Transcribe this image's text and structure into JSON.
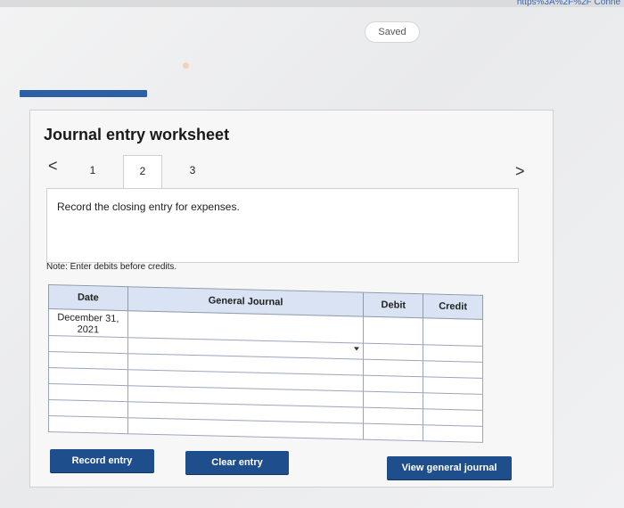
{
  "browser": {
    "url_fragment": "https%3A%2F%2F Conne"
  },
  "header": {
    "saved_label": "Saved"
  },
  "worksheet": {
    "title": "Journal entry worksheet",
    "nav_prev_glyph": "<",
    "nav_next_glyph": ">",
    "steps": [
      "1",
      "2",
      "3"
    ],
    "active_step": "2",
    "instruction": "Record the closing entry for expenses.",
    "note": "Note: Enter debits before credits."
  },
  "table": {
    "headers": {
      "date": "Date",
      "journal": "General Journal",
      "debit": "Debit",
      "credit": "Credit"
    },
    "date_line_1": "December 31,",
    "date_line_2": "2021"
  },
  "buttons": {
    "record": "Record entry",
    "clear": "Clear entry",
    "view": "View general journal"
  },
  "colors": {
    "accent_blue": "#1f4e8c",
    "header_fill": "#d9e3f3",
    "tab_blue": "#2d5fa6"
  },
  "icons": [
    "chevron-left-icon",
    "chevron-right-icon",
    "dropdown-arrow-icon"
  ]
}
